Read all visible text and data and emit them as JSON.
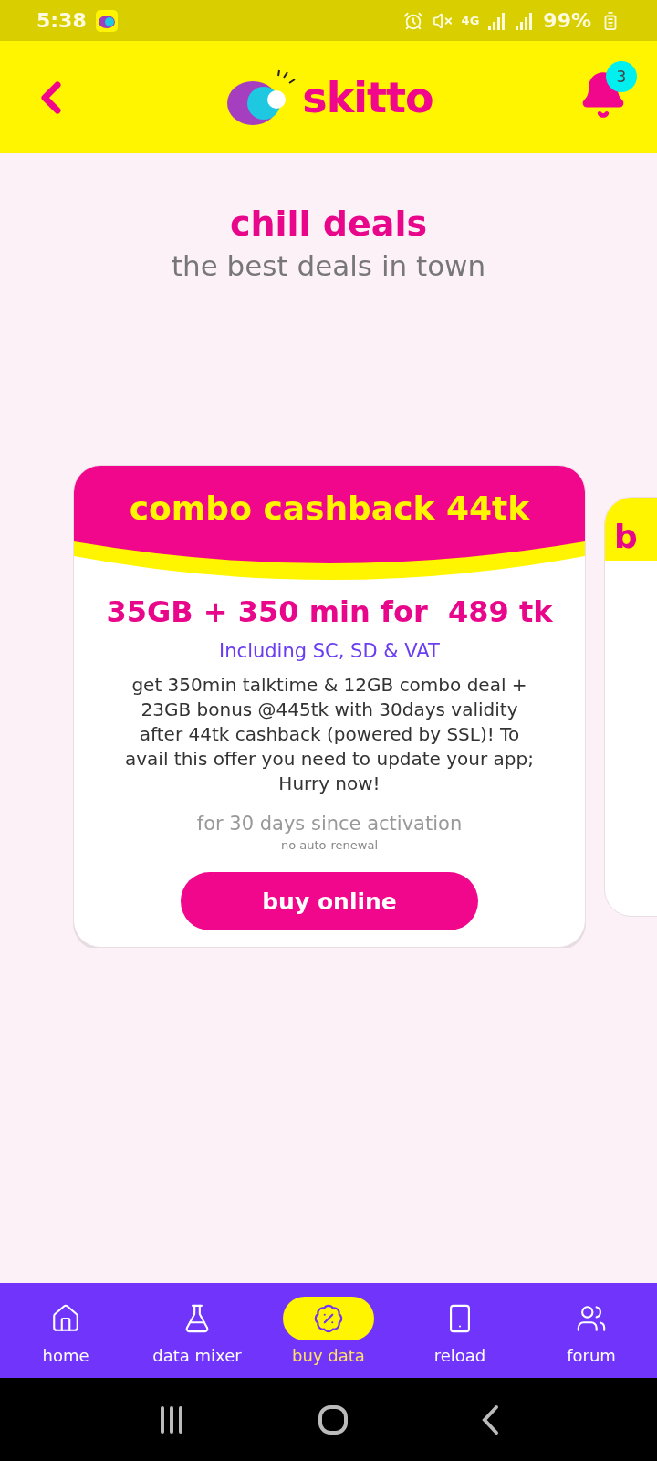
{
  "status_bar": {
    "time": "5:38",
    "network": "4G",
    "battery": "99%"
  },
  "header": {
    "brand": "skitto",
    "notification_count": "3"
  },
  "hero": {
    "title": "chill deals",
    "subtitle": "the best deals in town"
  },
  "deal_card": {
    "title": "combo cashback 44tk",
    "headline": "35GB + 350 min for  489 tk",
    "price_note": "Including SC, SD & VAT",
    "description": "get 350min talktime & 12GB combo deal + 23GB bonus @445tk with 30days validity after 44tk cashback (powered by SSL)! To avail this offer you need to update your app; Hurry now!",
    "validity": "for 30 days since activation",
    "renewal": "no auto-renewal",
    "button": "buy online"
  },
  "next_card": {
    "title": "b"
  },
  "bottom_nav": [
    {
      "label": "home",
      "kind": "home",
      "selected": false
    },
    {
      "label": "data mixer",
      "kind": "mixer",
      "selected": false
    },
    {
      "label": "buy data",
      "kind": "buy",
      "selected": true
    },
    {
      "label": "reload",
      "kind": "reload",
      "selected": false
    },
    {
      "label": "forum",
      "kind": "forum",
      "selected": false
    }
  ]
}
